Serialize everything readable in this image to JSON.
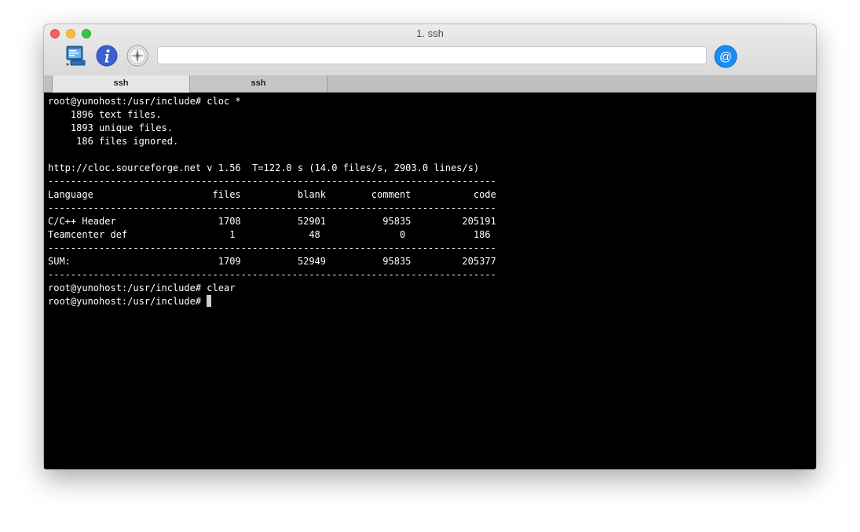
{
  "window": {
    "title": "1. ssh"
  },
  "toolbar": {
    "icons": [
      "terminal-icon",
      "info-icon",
      "compass-icon",
      "at-sign-icon"
    ],
    "search_value": ""
  },
  "tabs": [
    {
      "label": "ssh",
      "active": true
    },
    {
      "label": "ssh",
      "active": false
    }
  ],
  "terminal": {
    "lines": [
      "root@yunohost:/usr/include# cloc *",
      "    1896 text files.",
      "    1893 unique files.",
      "     186 files ignored.",
      "",
      "http://cloc.sourceforge.net v 1.56  T=122.0 s (14.0 files/s, 2903.0 lines/s)",
      "-------------------------------------------------------------------------------",
      "Language                     files          blank        comment           code",
      "-------------------------------------------------------------------------------",
      "C/C++ Header                  1708          52901          95835         205191",
      "Teamcenter def                  1             48              0            186",
      "-------------------------------------------------------------------------------",
      "SUM:                          1709          52949          95835         205377",
      "-------------------------------------------------------------------------------",
      "root@yunohost:/usr/include# clear",
      "root@yunohost:/usr/include# "
    ]
  },
  "colors": {
    "terminal_bg": "#000000",
    "terminal_fg": "#ffffff",
    "at_button": "#1a8cf0",
    "info_icon": "#3d5fd0"
  }
}
